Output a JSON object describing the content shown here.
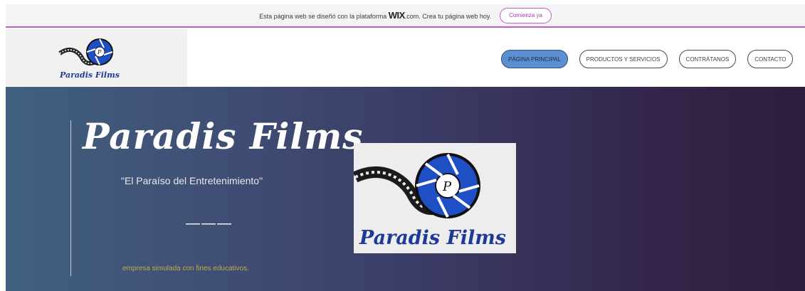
{
  "wix_banner": {
    "text_before": "Esta página web se diseñó con la plataforma",
    "brand": "WIX",
    "text_after": ".com. Crea tu página web hoy.",
    "cta_label": "Comienza ya"
  },
  "header": {
    "logo_text": "Paradis Films",
    "nav": [
      {
        "label": "PÁGINA PRINCIPAL",
        "active": true
      },
      {
        "label": "PRODUCTOS Y SERVICIOS",
        "active": false
      },
      {
        "label": "CONTRÁTANOS",
        "active": false
      },
      {
        "label": "CONTACTO",
        "active": false
      }
    ]
  },
  "hero": {
    "title": "Paradis Films",
    "subtitle": "\"El Paraíso del Entretenimiento\"",
    "separator": "———",
    "footnote": "empresa simulada con fines educativos.",
    "logo_text": "Paradis Films",
    "logo_letter": "P"
  },
  "colors": {
    "wix_accent": "#c25bc5",
    "nav_active": "#5c8fd1",
    "hero_left": "#41607f",
    "hero_right": "#2e1d3e",
    "logo_blue": "#1f4fc4",
    "footnote": "#c6a94a"
  }
}
